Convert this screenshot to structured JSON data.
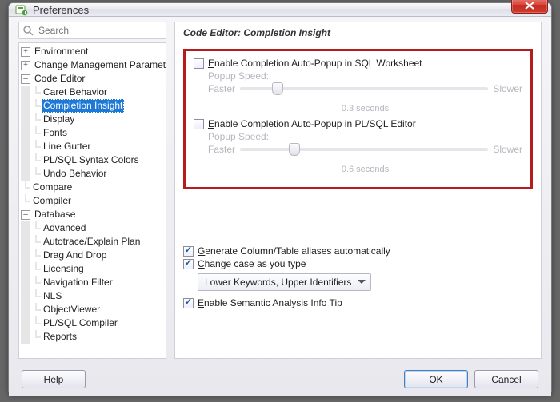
{
  "window": {
    "title": "Preferences"
  },
  "search": {
    "placeholder": "Search"
  },
  "tree": [
    {
      "level": 0,
      "exp": "+",
      "label": "Environment"
    },
    {
      "level": 0,
      "exp": "+",
      "label": "Change Management Parameters"
    },
    {
      "level": 0,
      "exp": "-",
      "label": "Code Editor",
      "open": true
    },
    {
      "level": 1,
      "exp": "",
      "label": "Caret Behavior"
    },
    {
      "level": 1,
      "exp": "",
      "label": "Completion Insight",
      "selected": true
    },
    {
      "level": 1,
      "exp": "",
      "label": "Display"
    },
    {
      "level": 1,
      "exp": "",
      "label": "Fonts"
    },
    {
      "level": 1,
      "exp": "",
      "label": "Line Gutter"
    },
    {
      "level": 1,
      "exp": "",
      "label": "PL/SQL Syntax Colors"
    },
    {
      "level": 1,
      "exp": "",
      "label": "Undo Behavior"
    },
    {
      "level": 0,
      "exp": "",
      "label": "Compare"
    },
    {
      "level": 0,
      "exp": "",
      "label": "Compiler"
    },
    {
      "level": 0,
      "exp": "-",
      "label": "Database",
      "open": true
    },
    {
      "level": 1,
      "exp": "",
      "label": "Advanced"
    },
    {
      "level": 1,
      "exp": "",
      "label": "Autotrace/Explain Plan"
    },
    {
      "level": 1,
      "exp": "",
      "label": "Drag And Drop"
    },
    {
      "level": 1,
      "exp": "",
      "label": "Licensing"
    },
    {
      "level": 1,
      "exp": "",
      "label": "Navigation Filter"
    },
    {
      "level": 1,
      "exp": "",
      "label": "NLS"
    },
    {
      "level": 1,
      "exp": "",
      "label": "ObjectViewer"
    },
    {
      "level": 1,
      "exp": "",
      "label": "PL/SQL Compiler"
    },
    {
      "level": 1,
      "exp": "",
      "label": "Reports"
    }
  ],
  "section": {
    "title": "Code Editor: Completion Insight"
  },
  "popup1": {
    "label_pre": "E",
    "label_post": "nable Completion Auto-Popup in SQL Worksheet",
    "speed_label": "Popup Speed:",
    "faster": "Faster",
    "slower": "Slower",
    "seconds": "0.3 seconds",
    "thumb_pct": 15
  },
  "popup2": {
    "label_pre": "E",
    "label_post": "nable Completion Auto-Popup in PL/SQL Editor",
    "speed_label": "Popup Speed:",
    "faster": "Faster",
    "slower": "Slower",
    "seconds": "0.6 seconds",
    "thumb_pct": 22
  },
  "opts": {
    "aliases_pre": "G",
    "aliases_post": "enerate Column/Table aliases automatically",
    "case_pre": "C",
    "case_post": "hange case as you type",
    "case_select": "Lower Keywords, Upper Identifiers",
    "semantic_pre": "E",
    "semantic_post": "nable Semantic Analysis Info Tip"
  },
  "buttons": {
    "help": "Help",
    "ok": "OK",
    "cancel": "Cancel"
  }
}
